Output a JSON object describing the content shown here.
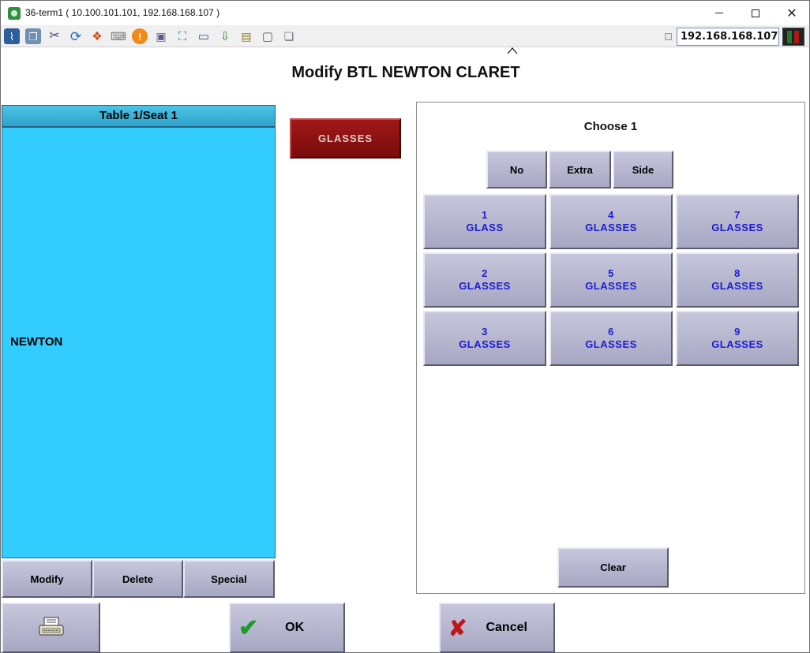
{
  "window": {
    "title": "36-term1 ( 10.100.101.101, 192.168.168.107 )"
  },
  "toolbar": {
    "icons": [
      "activity-icon",
      "windows-icon",
      "tools-icon",
      "refresh-icon",
      "windows-logo-icon",
      "keyboard-icon",
      "alert-icon",
      "network-icon",
      "fullscreen-icon",
      "monitor-icon",
      "download-icon",
      "notepad-icon",
      "screen-icon",
      "chat-icon"
    ],
    "ip_address": "192.168.168.107"
  },
  "heading": "Modify BTL NEWTON CLARET",
  "left": {
    "header": "Table 1/Seat 1",
    "items": [
      "NEWTON"
    ],
    "buttons": {
      "modify": "Modify",
      "delete": "Delete",
      "special": "Special"
    }
  },
  "category_button": "GLASSES",
  "right": {
    "choose_label": "Choose 1",
    "modifiers": {
      "no": "No",
      "extra": "Extra",
      "side": "Side"
    },
    "options": [
      {
        "num": "1",
        "unit": "GLASS"
      },
      {
        "num": "4",
        "unit": "GLASSES"
      },
      {
        "num": "7",
        "unit": "GLASSES"
      },
      {
        "num": "2",
        "unit": "GLASSES"
      },
      {
        "num": "5",
        "unit": "GLASSES"
      },
      {
        "num": "8",
        "unit": "GLASSES"
      },
      {
        "num": "3",
        "unit": "GLASSES"
      },
      {
        "num": "6",
        "unit": "GLASSES"
      },
      {
        "num": "9",
        "unit": "GLASSES"
      }
    ],
    "clear": "Clear"
  },
  "footer": {
    "ok": "OK",
    "cancel": "Cancel"
  },
  "colors": {
    "seat_panel": "#33ccff",
    "category_button": "#8b1010",
    "option_text": "#1c1cd6",
    "ok_check": "#1f9a2a",
    "cancel_x": "#c01818"
  }
}
